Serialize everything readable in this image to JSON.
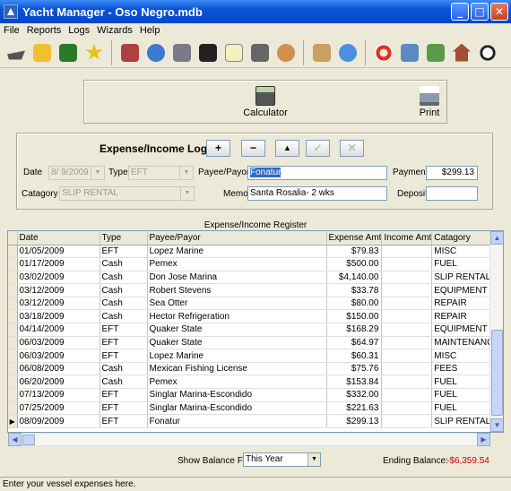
{
  "window": {
    "title": "Yacht Manager - Oso Negro.mdb"
  },
  "menu": [
    "File",
    "Reports",
    "Logs",
    "Wizards",
    "Help"
  ],
  "toolbar_icons": [
    "boat-icon",
    "folder-icon",
    "save-icon",
    "star-icon",
    "checkbook-icon",
    "globe-icon",
    "tools-icon",
    "boot-icon",
    "notepad-icon",
    "engine-icon",
    "people-icon",
    "clipboard-icon",
    "clock-icon",
    "life-ring-icon",
    "disk-icon",
    "money-icon",
    "house-icon",
    "magnifier-icon"
  ],
  "actions": {
    "calculator": "Calculator",
    "print": "Print"
  },
  "log": {
    "title": "Expense/Income Log",
    "nav": [
      "+",
      "−",
      "▲",
      "✓",
      "✕"
    ],
    "date_label": "Date",
    "date_value": "8/ 9/2009",
    "type_label": "Type",
    "type_value": "EFT",
    "payee_label": "Payee/Payor",
    "payee_value": "Fonatur",
    "payment_label": "Payment",
    "payment_value": "$299.13",
    "category_label": "Catagory",
    "category_value": "SLIP RENTAL",
    "memo_label": "Memo",
    "memo_value": "Santa Rosalia- 2 wks",
    "deposit_label": "Deposit",
    "deposit_value": ""
  },
  "register": {
    "title": "Expense/Income Register",
    "columns": [
      "Date",
      "Type",
      "Payee/Payor",
      "Expense Amt",
      "Income Amt",
      "Catagory"
    ],
    "rows": [
      [
        "01/05/2009",
        "EFT",
        "Lopez Marine",
        "$79.83",
        "",
        "MISC"
      ],
      [
        "01/17/2009",
        "Cash",
        "Pemex",
        "$500.00",
        "",
        "FUEL"
      ],
      [
        "03/02/2009",
        "Cash",
        "Don Jose Marina",
        "$4,140.00",
        "",
        "SLIP RENTAL"
      ],
      [
        "03/12/2009",
        "Cash",
        "Robert Stevens",
        "$33.78",
        "",
        "EQUIPMENT"
      ],
      [
        "03/12/2009",
        "Cash",
        "Sea Otter",
        "$80.00",
        "",
        "REPAIR"
      ],
      [
        "03/18/2009",
        "Cash",
        "Hector Refrigeration",
        "$150.00",
        "",
        "REPAIR"
      ],
      [
        "04/14/2009",
        "EFT",
        "Quaker State",
        "$168.29",
        "",
        "EQUIPMENT"
      ],
      [
        "06/03/2009",
        "EFT",
        "Quaker State",
        "$64.97",
        "",
        "MAINTENANCE"
      ],
      [
        "06/03/2009",
        "EFT",
        "Lopez Marine",
        "$60.31",
        "",
        "MISC"
      ],
      [
        "06/08/2009",
        "Cash",
        "Mexican Fishing License",
        "$75.76",
        "",
        "FEES"
      ],
      [
        "06/20/2009",
        "Cash",
        "Pemex",
        "$153.84",
        "",
        "FUEL"
      ],
      [
        "07/13/2009",
        "EFT",
        "Singlar Marina-Escondido",
        "$332.00",
        "",
        "FUEL"
      ],
      [
        "07/25/2009",
        "EFT",
        "Singlar Marina-Escondido",
        "$221.63",
        "",
        "FUEL"
      ],
      [
        "08/09/2009",
        "EFT",
        "Fonatur",
        "$299.13",
        "",
        "SLIP RENTAL"
      ]
    ]
  },
  "footer": {
    "show_balance_label": "Show Balance For",
    "show_balance_value": "This Year",
    "ending_label": "Ending Balance:",
    "ending_value": "-$6,359.54"
  },
  "status": "Enter your vessel expenses here."
}
